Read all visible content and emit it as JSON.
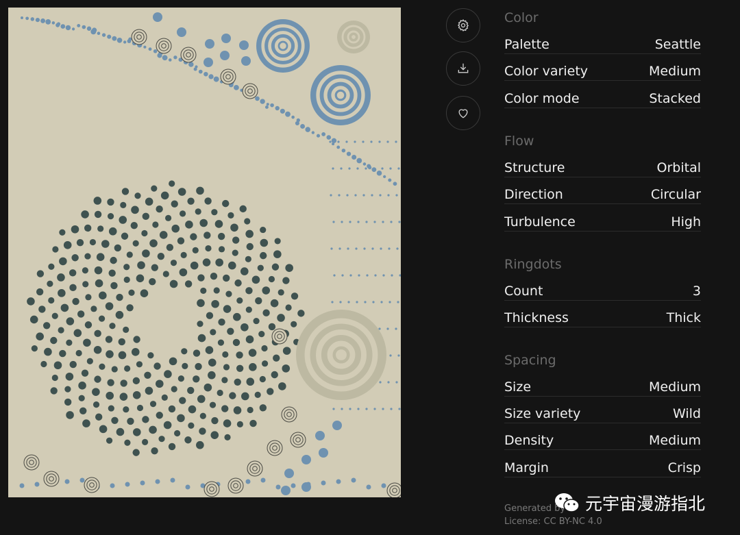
{
  "artwork": {
    "colors": {
      "background": "#d2ccb6",
      "dark_dots": "#3f5250",
      "blue": "#6f92b0",
      "pale": "#bdb9a2",
      "stroke": "#4a4a44"
    }
  },
  "toolbar": {
    "settings_icon": "gear-icon",
    "download_icon": "download-icon",
    "favorite_icon": "heart-icon"
  },
  "sections": [
    {
      "title": "Color",
      "rows": [
        {
          "label": "Palette",
          "value": "Seattle"
        },
        {
          "label": "Color variety",
          "value": "Medium"
        },
        {
          "label": "Color mode",
          "value": "Stacked"
        }
      ]
    },
    {
      "title": "Flow",
      "rows": [
        {
          "label": "Structure",
          "value": "Orbital"
        },
        {
          "label": "Direction",
          "value": "Circular"
        },
        {
          "label": "Turbulence",
          "value": "High"
        }
      ]
    },
    {
      "title": "Ringdots",
      "rows": [
        {
          "label": "Count",
          "value": "3"
        },
        {
          "label": "Thickness",
          "value": "Thick"
        }
      ]
    },
    {
      "title": "Spacing",
      "rows": [
        {
          "label": "Size",
          "value": "Medium"
        },
        {
          "label": "Size variety",
          "value": "Wild"
        },
        {
          "label": "Density",
          "value": "Medium"
        },
        {
          "label": "Margin",
          "value": "Crisp"
        }
      ]
    }
  ],
  "footer": {
    "generated": "Generated by",
    "license": "License: CC BY-NC 4.0"
  },
  "watermark": {
    "text": "元宇宙漫游指北"
  }
}
